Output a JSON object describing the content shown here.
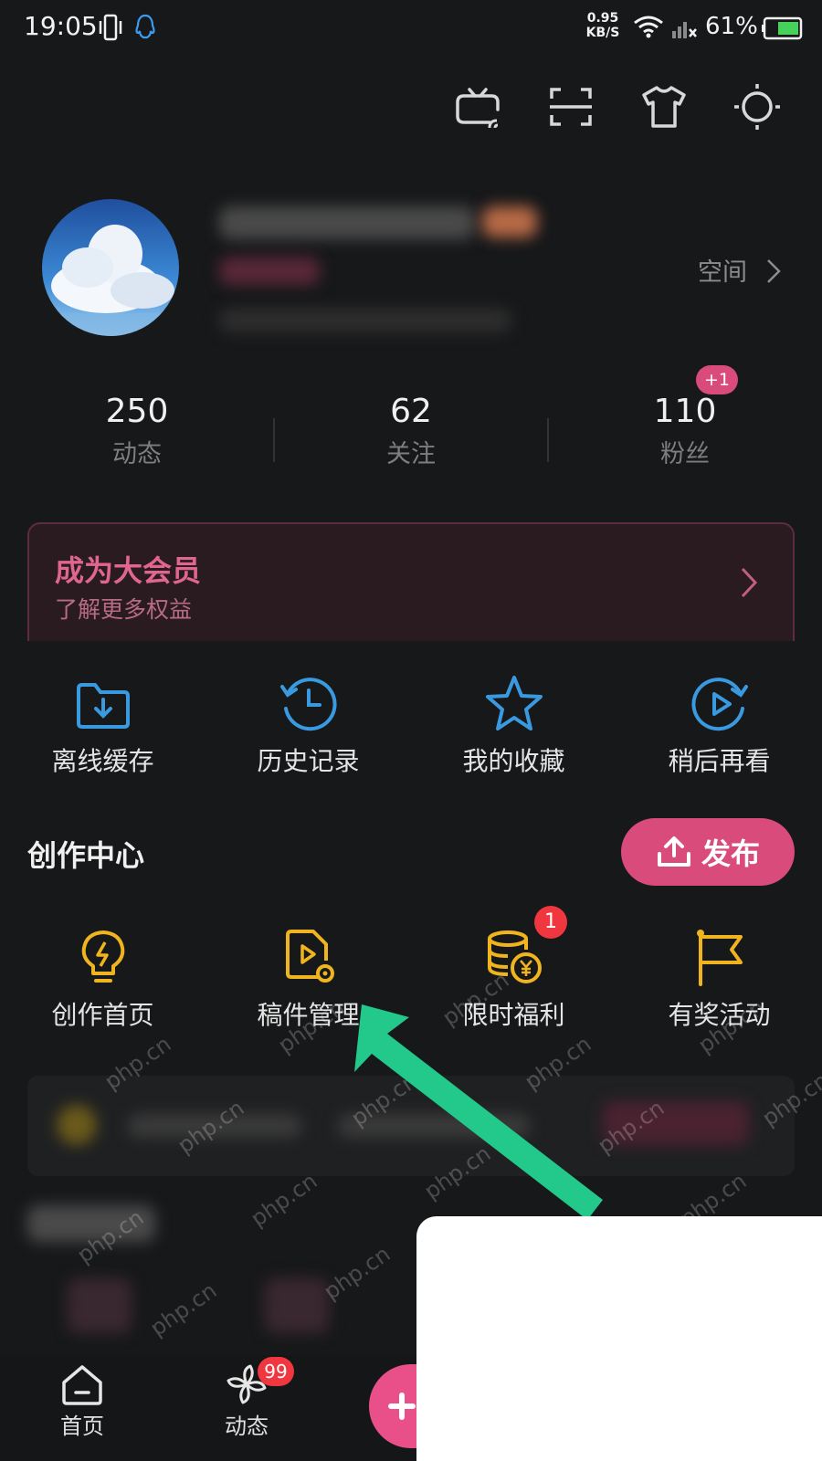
{
  "status_bar": {
    "time": "19:05",
    "net_speed_value": "0.95",
    "net_speed_unit": "KB/S",
    "battery": "61%"
  },
  "toolbar": {
    "icons": [
      "tv-icon",
      "scan-icon",
      "outfit-icon",
      "theme-icon"
    ]
  },
  "profile": {
    "space_link": "空间"
  },
  "stats": [
    {
      "value": "250",
      "label": "动态"
    },
    {
      "value": "62",
      "label": "关注"
    },
    {
      "value": "110",
      "label": "粉丝",
      "badge": "+1"
    }
  ],
  "vip": {
    "title": "成为大会员",
    "subtitle": "了解更多权益"
  },
  "quick_actions": [
    {
      "label": "离线缓存",
      "icon": "offline-cache-icon"
    },
    {
      "label": "历史记录",
      "icon": "history-icon"
    },
    {
      "label": "我的收藏",
      "icon": "favorite-star-icon"
    },
    {
      "label": "稍后再看",
      "icon": "watch-later-icon"
    }
  ],
  "creator_center": {
    "title": "创作中心",
    "publish_label": "发布",
    "items": [
      {
        "label": "创作首页",
        "icon": "bulb-icon"
      },
      {
        "label": "稿件管理",
        "icon": "manuscript-icon"
      },
      {
        "label": "限时福利",
        "icon": "coins-icon",
        "badge": "1"
      },
      {
        "label": "有奖活动",
        "icon": "flag-icon"
      }
    ]
  },
  "watermark_text": "php.cn",
  "bottom_nav": {
    "items": [
      {
        "label": "首页",
        "icon": "home-icon"
      },
      {
        "label": "动态",
        "icon": "pinwheel-icon",
        "badge": "99"
      }
    ]
  },
  "colors": {
    "background": "#17181a",
    "accent_pink": "#d94b7b",
    "icon_blue": "#3a9ae0",
    "icon_yellow": "#f0b41e",
    "arrow_green": "#22c98a"
  }
}
